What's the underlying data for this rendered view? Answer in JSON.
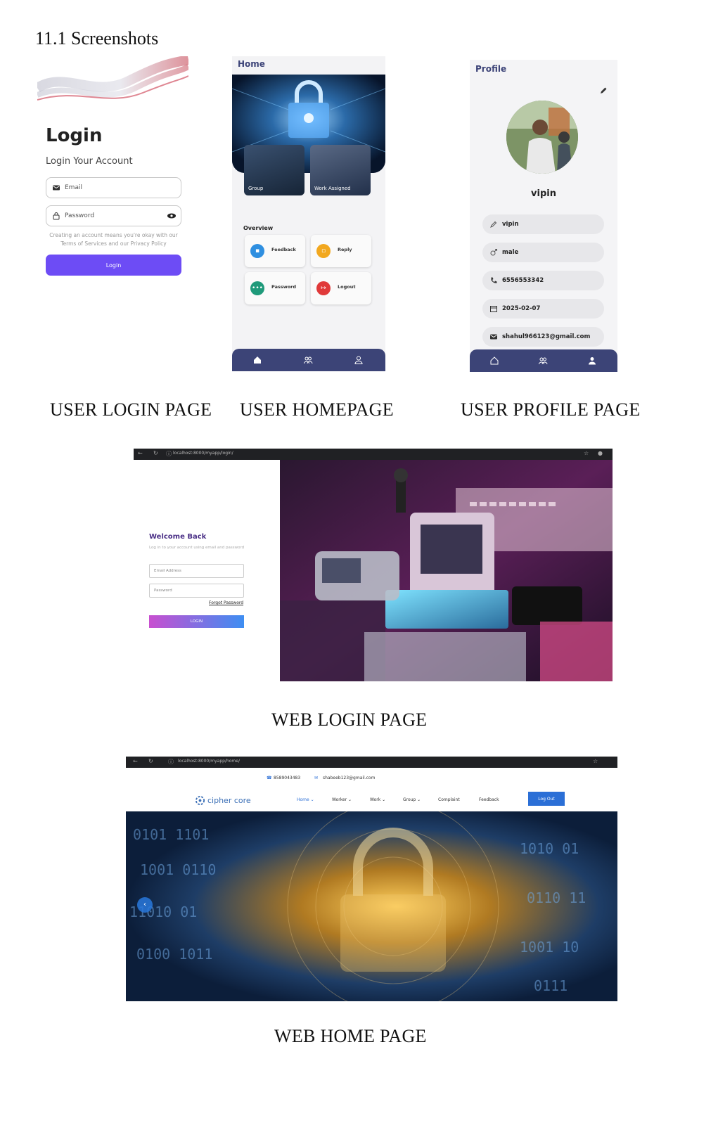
{
  "section_title": "11.1 Screenshots",
  "captions": {
    "user_login": "USER LOGIN PAGE",
    "user_home": "USER HOMEPAGE",
    "user_profile": "USER PROFILE PAGE",
    "web_login": "WEB LOGIN PAGE",
    "web_home": "WEB HOME PAGE"
  },
  "mobile_login": {
    "title": "Login",
    "subtitle": "Login Your Account",
    "email_placeholder": "Email",
    "password_placeholder": "Password",
    "terms_line1": "Creating an account means you're okay with our",
    "terms_line2": "Terms of Services and our Privacy Policy",
    "button": "Login",
    "accent": "#6d4cf5"
  },
  "mobile_home": {
    "header": "Home",
    "tiles": [
      "Group",
      "Work Assigned"
    ],
    "overview_title": "Overview",
    "cards": [
      {
        "label": "Feedback",
        "color": "#2f8fe0",
        "icon": "chat-icon"
      },
      {
        "label": "Reply",
        "color": "#f2a81f",
        "icon": "reply-icon"
      },
      {
        "label": "Password",
        "color": "#1f9a7a",
        "icon": "dots-icon"
      },
      {
        "label": "Logout",
        "color": "#e03a3a",
        "icon": "logout-icon"
      }
    ],
    "nav_color": "#3c4477"
  },
  "mobile_profile": {
    "header": "Profile",
    "name": "vipin",
    "fields": [
      {
        "icon": "pencil-icon",
        "value": "vipin"
      },
      {
        "icon": "male-icon",
        "value": "male"
      },
      {
        "icon": "phone-icon",
        "value": "6556553342"
      },
      {
        "icon": "calendar-icon",
        "value": "2025-02-07"
      },
      {
        "icon": "mail-icon",
        "value": "shahul966123@gmail.com"
      }
    ]
  },
  "web_login": {
    "url": "localhost:8000/myapp/login/",
    "title": "Welcome Back",
    "subtitle": "Log in to your account using email and password",
    "email_placeholder": "Email Address",
    "password_placeholder": "Password",
    "forgot": "Forgot Password",
    "button": "LOGIN"
  },
  "web_home": {
    "url": "localhost:8000/myapp/home/",
    "phone": "8589043483",
    "email": "shabeeb123@gmail.com",
    "logo": "cipher core",
    "menu": [
      "Home ⌄",
      "Worker ⌄",
      "Work ⌄",
      "Group ⌄",
      "Complaint",
      "Feedback"
    ],
    "logout": "Log Out",
    "brand_color": "#2b6fd6"
  }
}
